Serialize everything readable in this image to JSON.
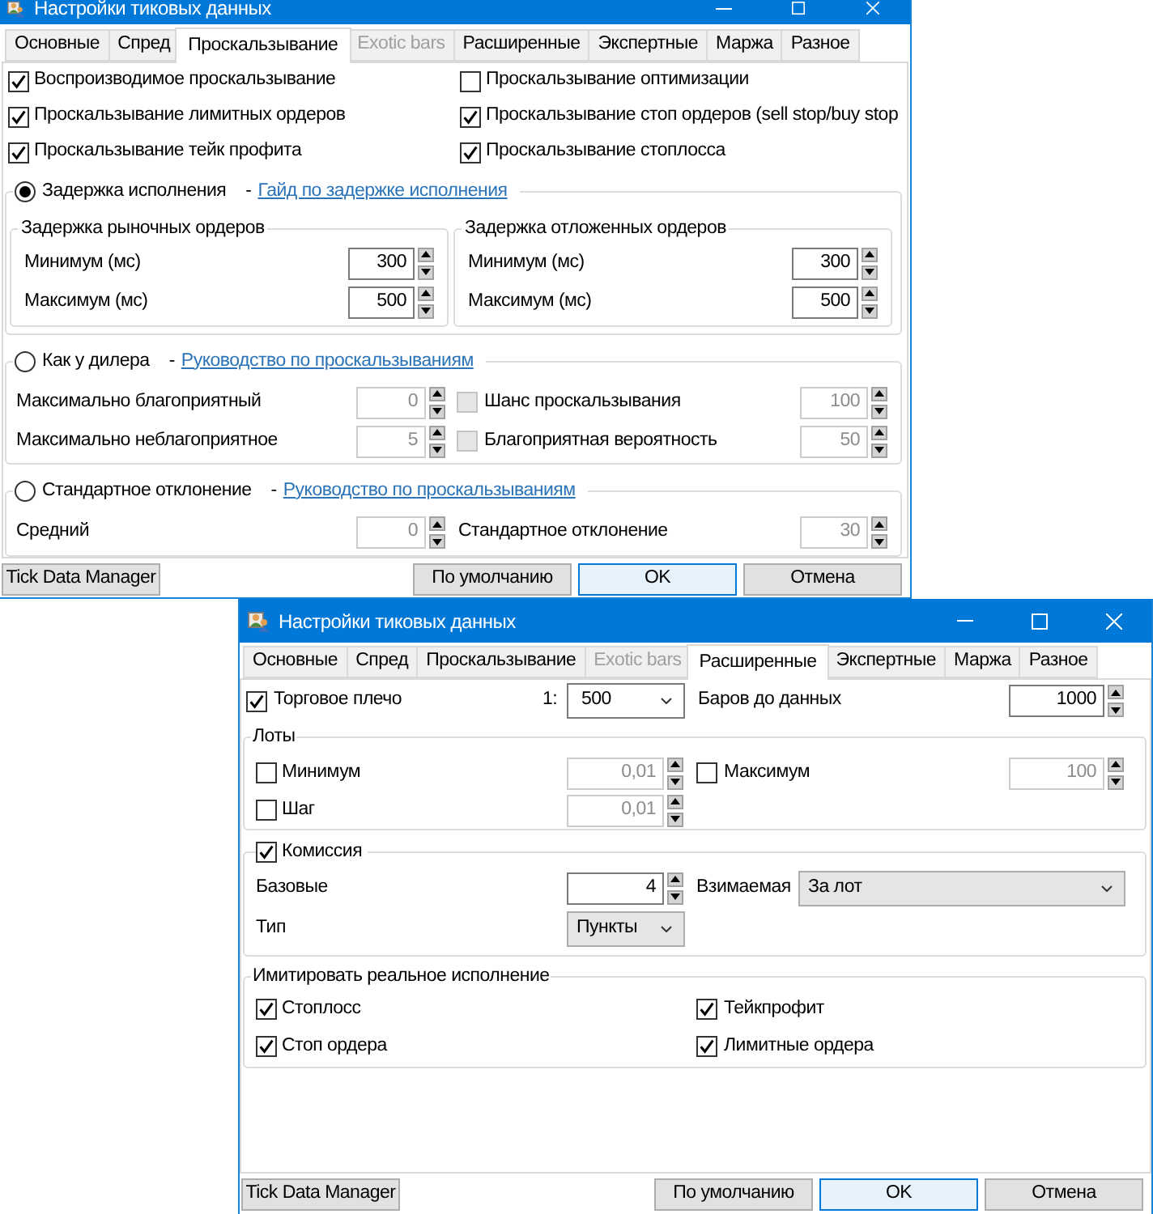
{
  "windows": [
    {
      "kind": "slippage",
      "title": "Настройки тиковых данных",
      "tabs": [
        {
          "label": "Основные",
          "selected": false,
          "disabled": false
        },
        {
          "label": "Спред",
          "selected": false,
          "disabled": false
        },
        {
          "label": "Проскальзывание",
          "selected": true,
          "disabled": false
        },
        {
          "label": "Exotic bars",
          "selected": false,
          "disabled": true
        },
        {
          "label": "Расширенные",
          "selected": false,
          "disabled": false
        },
        {
          "label": "Экспертные",
          "selected": false,
          "disabled": false
        },
        {
          "label": "Маржа",
          "selected": false,
          "disabled": false
        },
        {
          "label": "Разное",
          "selected": false,
          "disabled": false
        }
      ],
      "options": [
        {
          "label": "Воспроизводимое проскальзывание",
          "checked": true
        },
        {
          "label": "Проскальзывание оптимизации",
          "checked": false
        },
        {
          "label": "Проскальзывание лимитных ордеров",
          "checked": true
        },
        {
          "label": "Проскальзывание стоп ордеров (sell stop/buy stop",
          "checked": true
        },
        {
          "label": "Проскальзывание тейк профита",
          "checked": true
        },
        {
          "label": "Проскальзывание стоплосса",
          "checked": true
        }
      ],
      "modes": [
        {
          "kind": "delay",
          "label": "Задержка исполнения",
          "selected": true,
          "separator": "-",
          "link": "Гайд по задержке исполнения",
          "groups": [
            {
              "title": "Задержка рыночных ордеров",
              "fields": [
                {
                  "label": "Минимум (мс)",
                  "value": "300"
                },
                {
                  "label": "Максимум (мс)",
                  "value": "500"
                }
              ]
            },
            {
              "title": "Задержка отложенных ордеров",
              "fields": [
                {
                  "label": "Минимум (мс)",
                  "value": "300"
                },
                {
                  "label": "Максимум (мс)",
                  "value": "500"
                }
              ]
            }
          ]
        },
        {
          "kind": "dealer",
          "label": "Как у дилера",
          "selected": false,
          "separator": "-",
          "link": "Руководство по проскальзываниям",
          "rows": [
            {
              "label": "Максимально благоприятный",
              "value": "0",
              "option": {
                "label": "Шанс проскальзывания",
                "checked": false,
                "value": "100"
              }
            },
            {
              "label": "Максимально неблагоприятное",
              "value": "5",
              "option": {
                "label": "Благоприятная вероятность",
                "checked": false,
                "value": "50"
              }
            }
          ]
        },
        {
          "kind": "normal",
          "label": "Стандартное отклонение",
          "selected": false,
          "separator": "-",
          "link": "Руководство по проскальзываниям",
          "fields": [
            {
              "label": "Средний",
              "value": "0"
            },
            {
              "label": "Стандартное отклонение",
              "value": "30"
            }
          ]
        }
      ],
      "footer_buttons": [
        {
          "label": "Tick Data Manager",
          "default": false
        },
        {
          "label": "По умолчанию",
          "default": false
        },
        {
          "label": "OK",
          "default": true
        },
        {
          "label": "Отмена",
          "default": false
        }
      ]
    },
    {
      "kind": "advanced",
      "title": "Настройки тиковых данных",
      "tabs": [
        {
          "label": "Основные",
          "selected": false,
          "disabled": false
        },
        {
          "label": "Спред",
          "selected": false,
          "disabled": false
        },
        {
          "label": "Проскальзывание",
          "selected": false,
          "disabled": false
        },
        {
          "label": "Exotic bars",
          "selected": false,
          "disabled": true
        },
        {
          "label": "Расширенные",
          "selected": true,
          "disabled": false
        },
        {
          "label": "Экспертные",
          "selected": false,
          "disabled": false
        },
        {
          "label": "Маржа",
          "selected": false,
          "disabled": false
        },
        {
          "label": "Разное",
          "selected": false,
          "disabled": false
        }
      ],
      "leverage": {
        "label": "Торговое плечо",
        "checked": true,
        "prefix": "1:",
        "value": "500"
      },
      "bars": {
        "label": "Баров до данных",
        "value": "1000"
      },
      "lots": {
        "title": "Лоты",
        "fields": [
          {
            "label": "Минимум",
            "checked": false,
            "value": "0,01"
          },
          {
            "label": "Максимум",
            "checked": false,
            "value": "100"
          },
          {
            "label": "Шаг",
            "checked": false,
            "value": "0,01"
          }
        ]
      },
      "commission": {
        "label": "Комиссия",
        "checked": true,
        "base": {
          "label": "Базовые",
          "value": "4"
        },
        "charged": {
          "label": "Взимаемая",
          "value": "За лот"
        },
        "type": {
          "label": "Тип",
          "value": "Пункты"
        }
      },
      "real_execution": {
        "title": "Имитировать реальное исполнение",
        "options": [
          {
            "label": "Стоплосс",
            "checked": true
          },
          {
            "label": "Тейкпрофит",
            "checked": true
          },
          {
            "label": "Стоп ордера",
            "checked": true
          },
          {
            "label": "Лимитные ордера",
            "checked": true
          }
        ]
      },
      "footer_buttons": [
        {
          "label": "Tick Data Manager",
          "default": false
        },
        {
          "label": "По умолчанию",
          "default": false
        },
        {
          "label": "OK",
          "default": true
        },
        {
          "label": "Отмена",
          "default": false
        }
      ]
    }
  ]
}
